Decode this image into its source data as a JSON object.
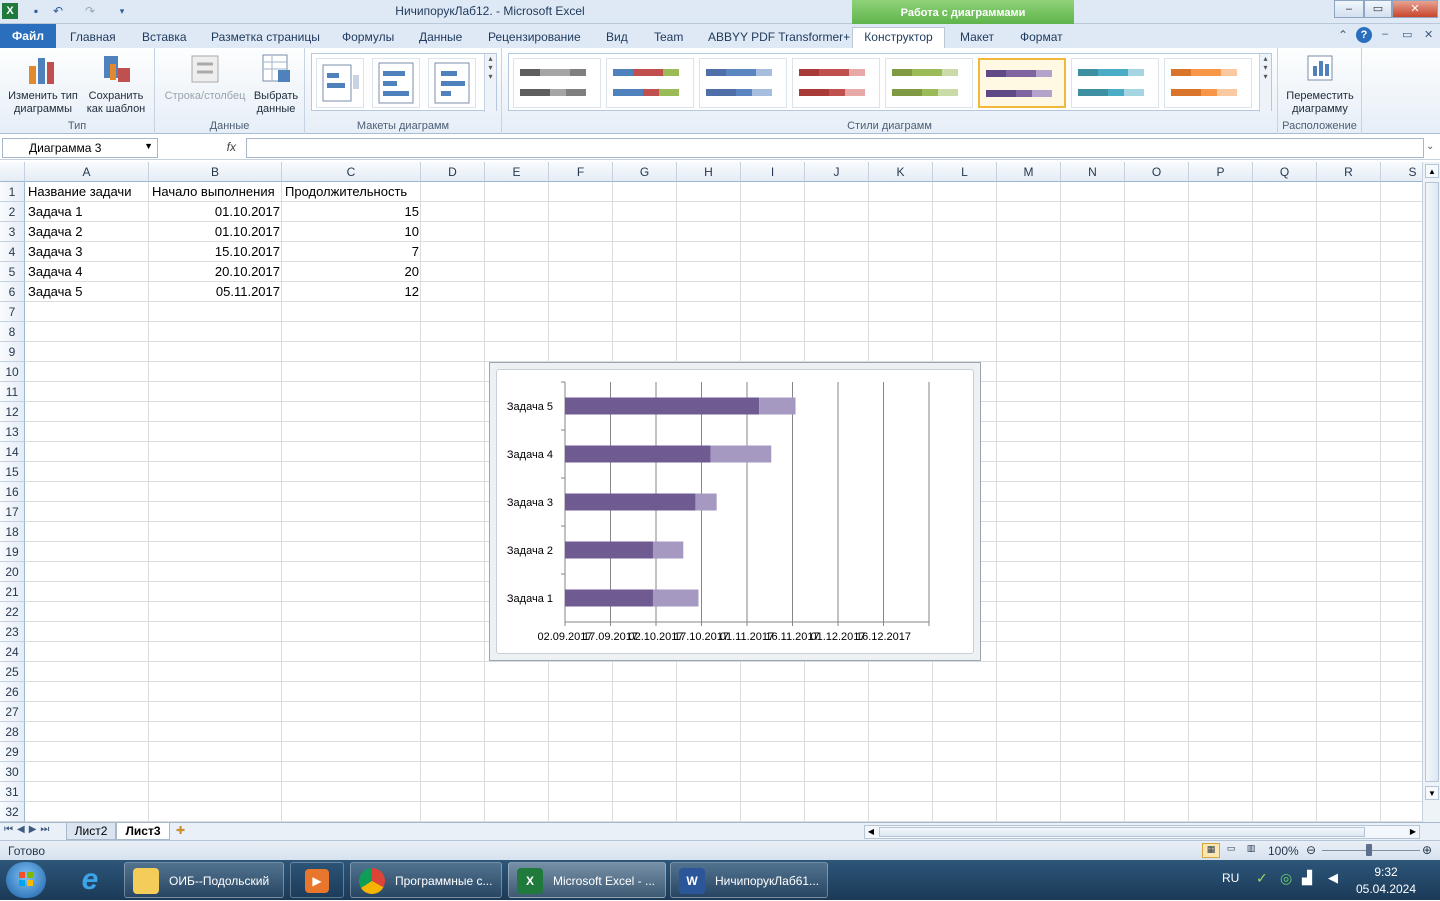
{
  "window": {
    "title": "НичипорукЛаб12. - Microsoft Excel",
    "contextual_band": "Работа с диаграммами",
    "buttons": [
      "–",
      "▭",
      "✕"
    ]
  },
  "tabs": [
    {
      "label": "Файл"
    },
    {
      "label": "Главная"
    },
    {
      "label": "Вставка"
    },
    {
      "label": "Разметка страницы"
    },
    {
      "label": "Формулы"
    },
    {
      "label": "Данные"
    },
    {
      "label": "Рецензирование"
    },
    {
      "label": "Вид"
    },
    {
      "label": "Team"
    },
    {
      "label": "ABBYY PDF Transformer+"
    },
    {
      "label": "Конструктор"
    },
    {
      "label": "Макет"
    },
    {
      "label": "Формат"
    }
  ],
  "ribbon": {
    "type_group": {
      "label": "Тип",
      "change_type": "Изменить тип\nдиаграммы",
      "save_template": "Сохранить\nкак шаблон"
    },
    "data_group": {
      "label": "Данные",
      "row_col": "Строка/столбец",
      "select_data": "Выбрать\nданные"
    },
    "layouts_label": "Макеты диаграмм",
    "styles_label": "Стили диаграмм",
    "location_group": {
      "label": "Расположение",
      "move_chart": "Переместить\nдиаграмму"
    },
    "style_colors": [
      [
        "#5e5e5e",
        "#a5a5a5",
        "#7f7f7f"
      ],
      [
        "#4f81bd",
        "#c0504d",
        "#9bbb59"
      ],
      [
        "#4f6fa8",
        "#5b85c0",
        "#a6bde0"
      ],
      [
        "#a83a38",
        "#c0504d",
        "#e6a9a8"
      ],
      [
        "#7f9a42",
        "#9bbb59",
        "#cbdba8"
      ],
      [
        "#5f4a87",
        "#8064a2",
        "#b3a3cc"
      ],
      [
        "#3f8fa3",
        "#4bacc6",
        "#a5d5e3"
      ],
      [
        "#d9752b",
        "#f79646",
        "#fbc9a1"
      ]
    ]
  },
  "formula_bar": {
    "name_box": "Диаграмма 3",
    "fx": "fx",
    "formula": ""
  },
  "columns": [
    "A",
    "B",
    "C",
    "D",
    "E",
    "F",
    "G",
    "H",
    "I",
    "J",
    "K",
    "L",
    "M",
    "N",
    "O",
    "P",
    "Q",
    "R",
    "S"
  ],
  "rows": [
    "1",
    "2",
    "3",
    "4",
    "5",
    "6",
    "7",
    "8",
    "9",
    "10",
    "11",
    "12",
    "13",
    "14",
    "15",
    "16",
    "17",
    "18",
    "19",
    "20",
    "21",
    "22",
    "23",
    "24",
    "25",
    "26",
    "27",
    "28",
    "29",
    "30",
    "31",
    "32"
  ],
  "table": {
    "headers": [
      "Название задачи",
      "Начало выполнения",
      "Продолжительность"
    ],
    "rows": [
      [
        "Задача 1",
        "01.10.2017",
        "15"
      ],
      [
        "Задача 2",
        "01.10.2017",
        "10"
      ],
      [
        "Задача 3",
        "15.10.2017",
        "7"
      ],
      [
        "Задача 4",
        "20.10.2017",
        "20"
      ],
      [
        "Задача 5",
        "05.11.2017",
        "12"
      ]
    ]
  },
  "chart_data": {
    "type": "bar",
    "orientation": "horizontal",
    "stacked": true,
    "categories": [
      "Задача 1",
      "Задача 2",
      "Задача 3",
      "Задача 4",
      "Задача 5"
    ],
    "series": [
      {
        "start": [
          "01.10.2017",
          "01.10.2017",
          "15.10.2017",
          "20.10.2017",
          "05.11.2017"
        ],
        "color": "#6f5b91"
      },
      {
        "values": [
          15,
          10,
          7,
          20,
          12
        ],
        "color": "#a599c2"
      }
    ],
    "x_ticks": [
      "02.09.2017",
      "17.09.2017",
      "02.10.2017",
      "17.10.2017",
      "01.11.2017",
      "16.11.2017",
      "01.12.2017",
      "16.12.2017",
      "31.12.2017"
    ],
    "x_tick_labels": [
      "02.09.2017",
      "17.09.2017",
      "02.10.2017",
      "17.10.2017",
      "01.11.2017",
      "16.11.2017",
      "01.12.2017",
      "16.12.2017"
    ],
    "xlim": [
      "02.09.2017",
      "31.12.2017"
    ],
    "grid": "vertical",
    "legend": "none",
    "title": ""
  },
  "sheets": [
    "Лист2",
    "Лист3"
  ],
  "status": {
    "ready": "Готово",
    "zoom": "100%"
  },
  "taskbar": {
    "items": [
      "ОИБ--Подольский",
      "Программные с...",
      "Microsoft Excel - ...",
      "НичипорукЛаб61..."
    ],
    "lang": "RU",
    "time": "9:32",
    "date": "05.04.2024"
  }
}
